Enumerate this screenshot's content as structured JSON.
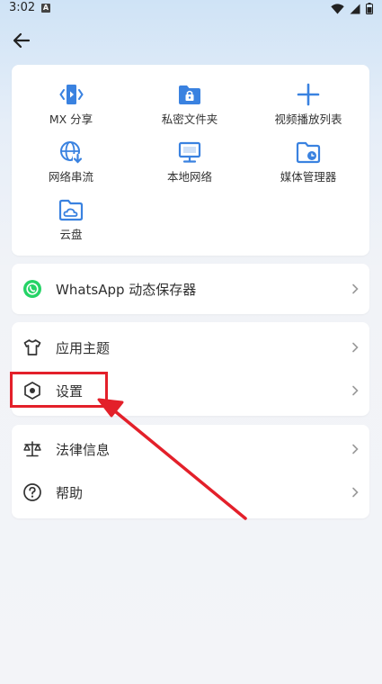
{
  "status": {
    "time": "3:02",
    "notif_letter": "A"
  },
  "grid": [
    {
      "label": "MX 分享",
      "icon": "mx-share-icon"
    },
    {
      "label": "私密文件夹",
      "icon": "private-folder-icon"
    },
    {
      "label": "视频播放列表",
      "icon": "add-playlist-icon"
    },
    {
      "label": "网络串流",
      "icon": "network-stream-icon"
    },
    {
      "label": "本地网络",
      "icon": "local-network-icon"
    },
    {
      "label": "媒体管理器",
      "icon": "media-manager-icon"
    },
    {
      "label": "云盘",
      "icon": "cloud-drive-icon"
    }
  ],
  "rows": {
    "whatsapp": "WhatsApp 动态保存器",
    "theme": "应用主题",
    "settings": "设置",
    "legal": "法律信息",
    "help": "帮助"
  },
  "colors": {
    "accent": "#3a82e0",
    "whatsapp": "#25d366",
    "highlight": "#e3202a"
  }
}
